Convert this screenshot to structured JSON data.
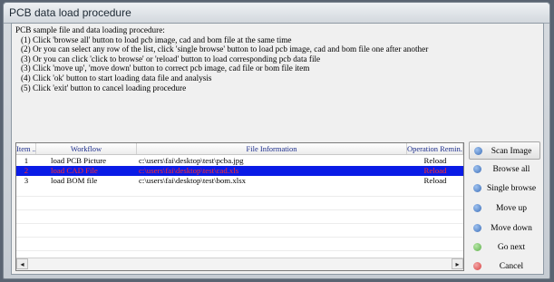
{
  "window": {
    "title": "PCB data load procedure"
  },
  "instructions": {
    "intro": "PCB sample file and data loading procedure:",
    "lines": [
      "(1) Click 'browse all' button to load pcb image, cad and bom file at the same time",
      "(2) Or you can select any row of the list, click 'single browse' button to load pcb image, cad and bom file one after another",
      "(3) Or you can click 'click to browse' or 'reload' button to load corresponding pcb data file",
      "(3) Click 'move up', 'move down' button to correct pcb image, cad file or bom file item",
      "(4) Click 'ok' button to start loading data file and analysis",
      "(5) Click 'exit' button to cancel loading procedure"
    ]
  },
  "table": {
    "columns": [
      "Item ...",
      "Workflow",
      "File Information",
      "Operation Remin..."
    ],
    "rows": [
      {
        "item": "1",
        "workflow": "load PCB Picture",
        "file": "c:\\users\\fai\\desktop\\test\\pcba.jpg",
        "op": "Reload"
      },
      {
        "item": "2",
        "workflow": "load CAD File",
        "file": "c:\\users\\fai\\desktop\\test\\cad.xls",
        "op": "Reload"
      },
      {
        "item": "3",
        "workflow": "load BOM file",
        "file": "c:\\users\\fai\\desktop\\test\\bom.xlsx",
        "op": "Reload"
      }
    ],
    "selected_row": 2,
    "scroll_left": "◂",
    "scroll_right": "▸"
  },
  "buttons": {
    "scan_image": "Scan Image",
    "browse_all": "Browse all",
    "single_browse": "Single browse",
    "move_up": "Move up",
    "move_down": "Move down",
    "go_next": "Go next",
    "cancel": "Cancel"
  },
  "colors": {
    "icon_blue": "#3d6fb8",
    "icon_green": "#5cb04a",
    "icon_red": "#d84040",
    "selection": "#0a1be6",
    "selection_text": "#ff2b2b",
    "header_text": "#1d2e8c"
  }
}
